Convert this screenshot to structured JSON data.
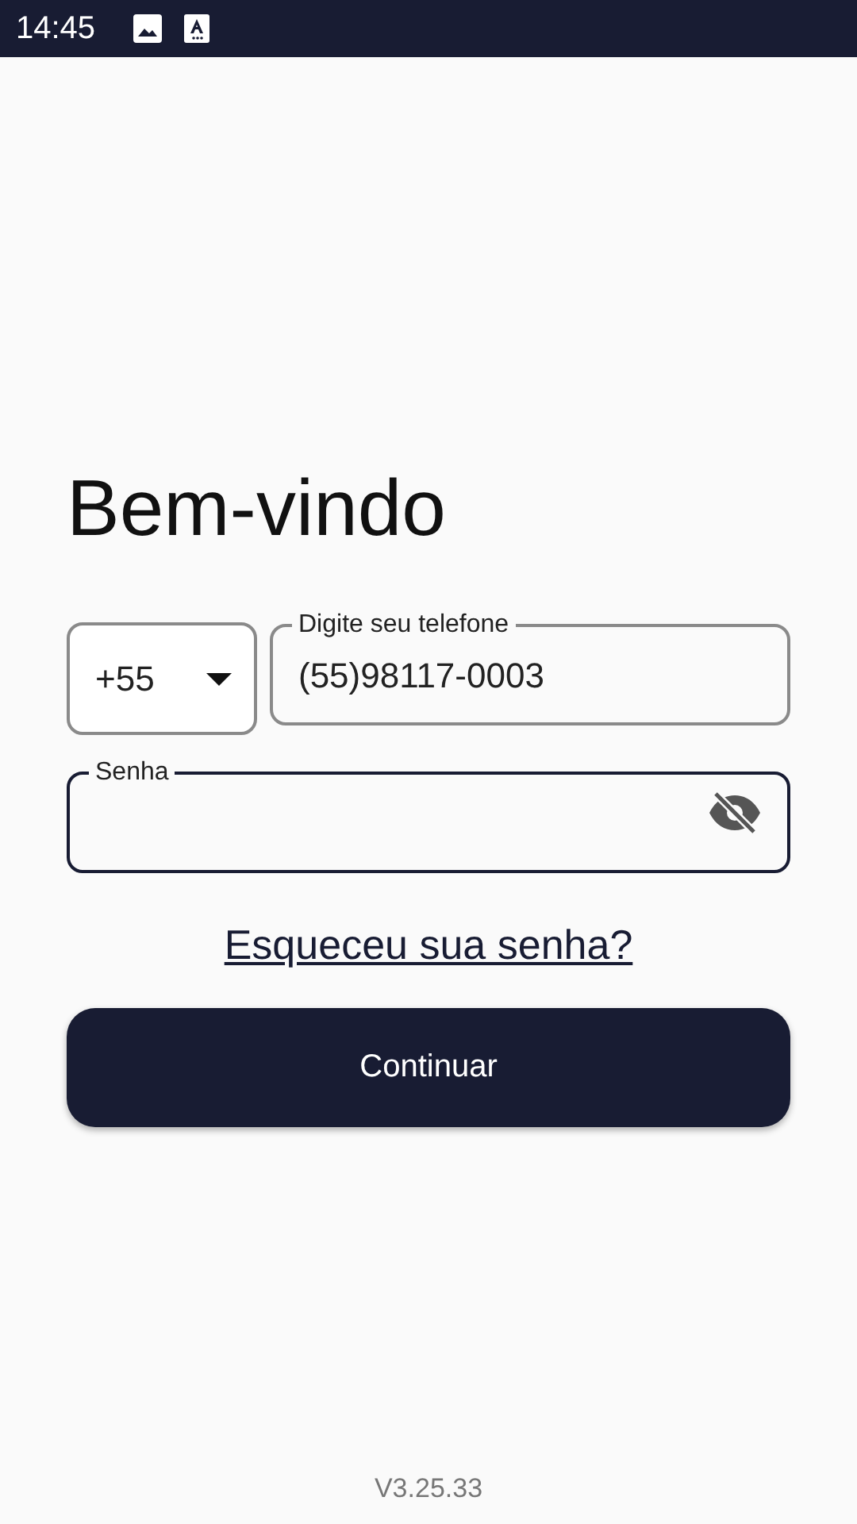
{
  "status_bar": {
    "time": "14:45"
  },
  "title": "Bem-vindo",
  "country_code": {
    "value": "+55"
  },
  "phone": {
    "label": "Digite seu telefone",
    "value": "(55)98117-0003",
    "focused": false
  },
  "password": {
    "label": "Senha",
    "focused": true,
    "visible": false
  },
  "forgot_link": "Esqueceu sua senha?",
  "continue_button": "Continuar",
  "version": "V3.25.33"
}
